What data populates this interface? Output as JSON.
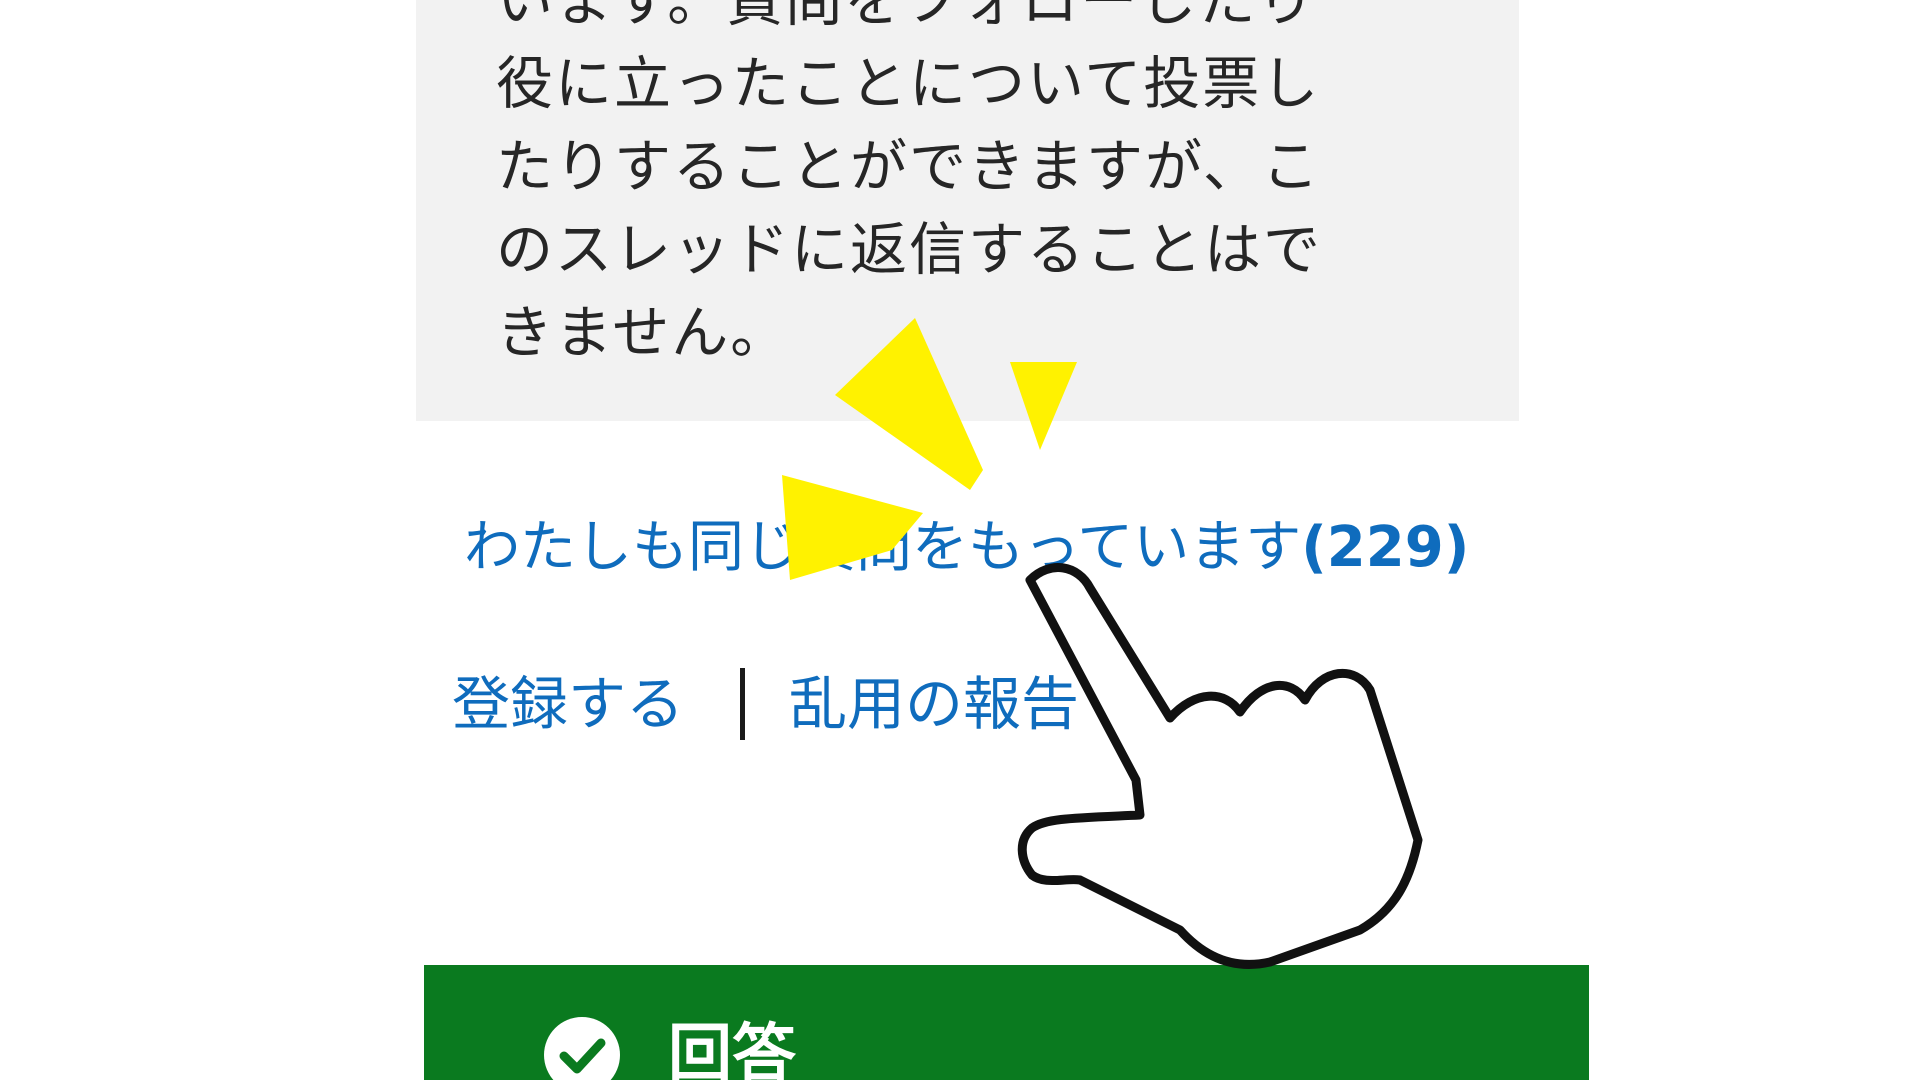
{
  "notice": {
    "lines": [
      "います。質問をフォローしたり",
      "役に立ったことについて投票し",
      "たりすることができますが、こ",
      "のスレッドに返信することはで",
      "きません。"
    ]
  },
  "same_question": {
    "label": "わたしも同じ質問をもっています",
    "count": "(229)"
  },
  "actions": {
    "subscribe": "登録する",
    "report_abuse": "乱用の報告"
  },
  "answer": {
    "title": "回答"
  },
  "colors": {
    "link": "#0f6cbd",
    "answer_bg": "#0a7a1f",
    "notice_bg": "#f2f2f2",
    "highlight": "#ffff00"
  },
  "icons": {
    "checkmark": "check-circle-icon",
    "pointer": "pointing-hand-icon",
    "highlight": "sparkle-burst-icon"
  }
}
